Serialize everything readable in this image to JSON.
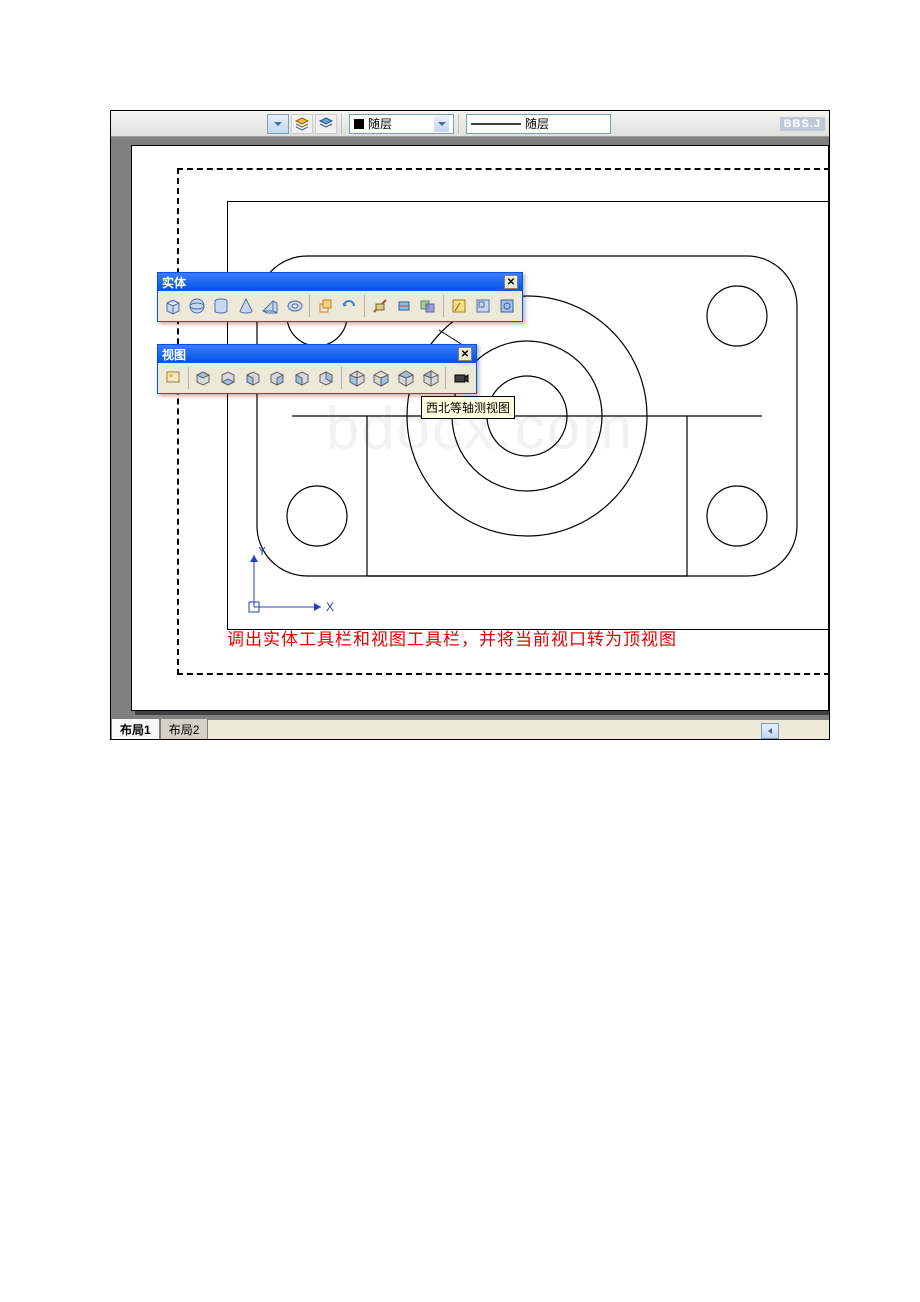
{
  "toolbar": {
    "layer_combo": "随层",
    "linetype_combo": "随层",
    "bbs_tag": "BBS.J"
  },
  "solids_toolbar": {
    "title": "实体"
  },
  "views_toolbar": {
    "title": "视图",
    "tooltip": "西北等轴测视图"
  },
  "ucs": {
    "x_label": "X",
    "y_label": "Y"
  },
  "annotation": "调出实体工具栏和视图工具栏，并将当前视口转为顶视图",
  "watermark": "bdocx.com",
  "tabs": {
    "tab1": "布局1",
    "tab2": "布局2"
  }
}
